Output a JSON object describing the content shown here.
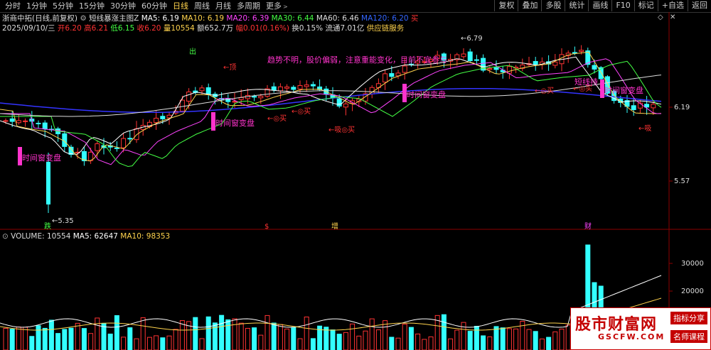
{
  "toolbar": {
    "tabs": [
      {
        "label": "分时"
      },
      {
        "label": "1分钟"
      },
      {
        "label": "5分钟"
      },
      {
        "label": "15分钟"
      },
      {
        "label": "30分钟"
      },
      {
        "label": "60分钟"
      },
      {
        "label": "日线"
      },
      {
        "label": "周线"
      },
      {
        "label": "月线"
      },
      {
        "label": "多周期"
      },
      {
        "label": "更多"
      }
    ],
    "right_buttons": [
      {
        "label": "复权"
      },
      {
        "label": "叠加"
      },
      {
        "label": "多股"
      },
      {
        "label": "统计"
      },
      {
        "label": "画线"
      },
      {
        "label": "F10"
      },
      {
        "label": "标记"
      },
      {
        "label": "+自选"
      },
      {
        "label": "返回"
      }
    ]
  },
  "header": {
    "stock": "浙商中拓(日线,前复权)",
    "indicator": "短线暴涨主图Z",
    "ma5": "MA5: 6.19",
    "ma10": "MA10: 6.19",
    "ma20": "MA20: 6.39",
    "ma30": "MA30: 6.44",
    "ma60": "MA60: 6.46",
    "ma120": "MA120: 6.20",
    "buy_flag": "买",
    "date": "2025/09/10/三",
    "open": "开6.20",
    "high": "高6.21",
    "low": "低6.15",
    "close": "收6.20",
    "volume": "量10554",
    "amount": "额652.7万",
    "change": "幅0.01(0.16%)",
    "turnover": "换0.15%",
    "float": "流通7.01亿",
    "sector": "供应链服务"
  },
  "colors": {
    "ma5": "#ffffff",
    "ma10": "#ffd34d",
    "ma20": "#ff44ff",
    "ma30": "#44ff44",
    "ma60": "#dddddd",
    "ma120": "#3333ff",
    "up": "#ff3333",
    "down": "#33ffff",
    "magenta": "#ff33cc"
  },
  "price_axis": {
    "labels": [
      {
        "value": "6.19",
        "ypos": "p1"
      },
      {
        "value": "5.57",
        "ypos": "p2"
      }
    ]
  },
  "annotations": {
    "trend_text": "趋势不明，股价偏弱，注意重能变化，目前不宜参与",
    "time_window_1": "时间窗",
    "time_window_1b": "变盘",
    "time_window_2": "时间窗",
    "time_window_2b": "变盘",
    "time_window_3": "时间窗",
    "time_window_3b": "变盘",
    "time_window_4": "时间窗",
    "time_window_4b": "变盘",
    "ding": "←顶",
    "chu": "出",
    "buy1": "←◎买",
    "buy2": "←◎买",
    "xi_buy": "←吸◎买",
    "buy3": "←◎买",
    "buy4": "←◎买",
    "xi": "←吸",
    "hold": "短线持",
    "high_mark": "←6.79",
    "low_mark": "←5.35",
    "die": "跌",
    "zeng": "增",
    "cai": "财",
    "dollar": "$"
  },
  "volume": {
    "label": "VOLUME: 10554",
    "ma5": "MA5: 62647",
    "ma10": "MA10: 98353",
    "axis": [
      "30000",
      "20000"
    ]
  },
  "watermark": {
    "title": "股市财富网",
    "url": "GSCFW.COM",
    "tag1": "指标分享",
    "tag2": "名师课程"
  }
}
